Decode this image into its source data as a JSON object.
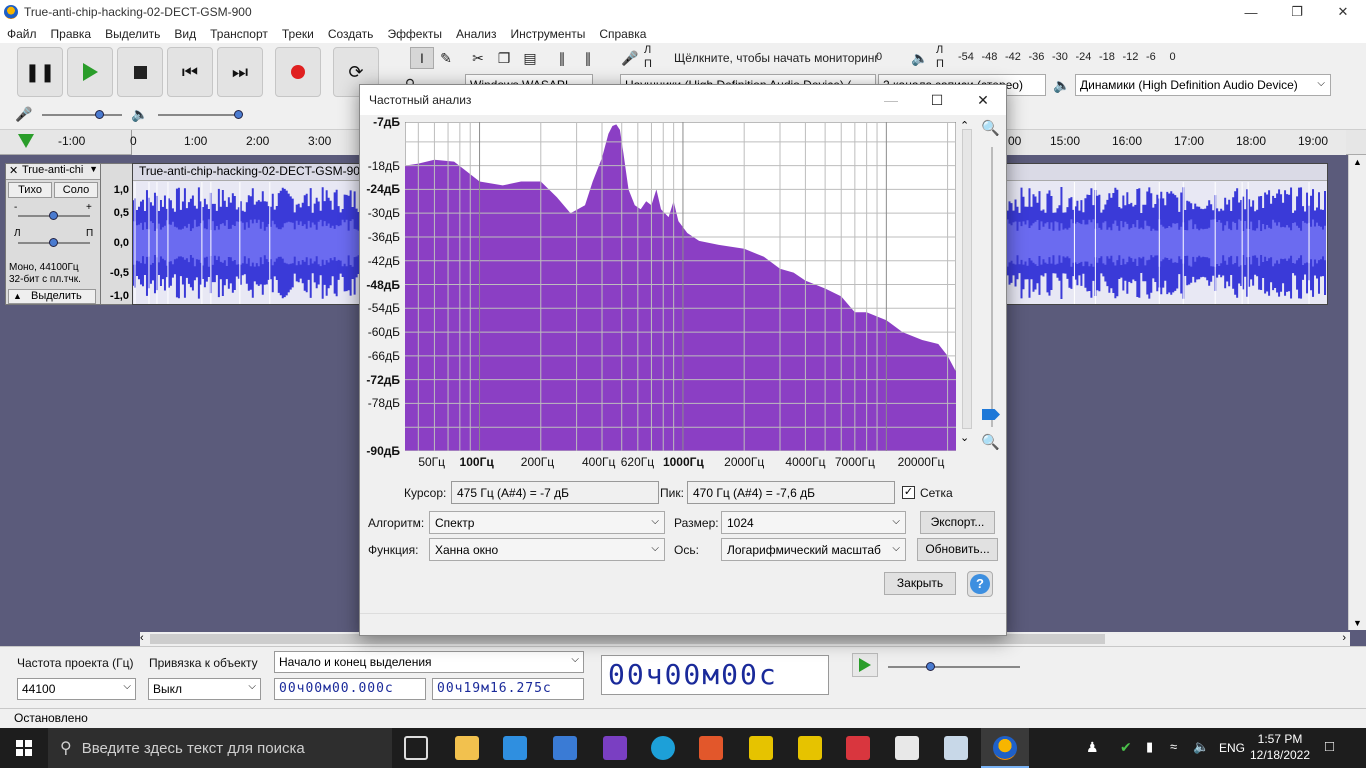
{
  "window": {
    "title": "True-anti-chip-hacking-02-DECT-GSM-900"
  },
  "menu": [
    "Файл",
    "Правка",
    "Выделить",
    "Вид",
    "Транспорт",
    "Треки",
    "Создать",
    "Эффекты",
    "Анализ",
    "Инструменты",
    "Справка"
  ],
  "toolbar": {
    "monitor_text": "Щёлкните, чтобы начать мониторинг",
    "monitor_zero": "0",
    "meter_ticks": [
      "-54",
      "-48",
      "-42",
      "-36",
      "-30",
      "-24",
      "-18",
      "-12",
      "-6",
      "0"
    ],
    "host": "Windows WASAPI",
    "mic_device": "Наушники (High Definition Audio Device) (",
    "channels": "2 канала записи (стерео)",
    "speaker_device": "Динамики (High Definition Audio Device)",
    "lp_l": "Л",
    "lp_r": "П"
  },
  "timeline": {
    "left_ticks": [
      "-1:00",
      "0",
      "1:00",
      "2:00",
      "3:00"
    ],
    "right_ticks": [
      "00",
      "15:00",
      "16:00",
      "17:00",
      "18:00",
      "19:00"
    ]
  },
  "track": {
    "name": "True-anti-chi",
    "clip_name": "True-anti-chip-hacking-02-DECT-GSM-900",
    "mute": "Тихо",
    "solo": "Соло",
    "pan_l": "Л",
    "pan_r": "П",
    "info_line1": "Моно, 44100Гц",
    "info_line2": "32-бит с пл.тчк.",
    "select": "Выделить",
    "scale": [
      "1,0",
      "0,5",
      "0,0",
      "-0,5",
      "-1,0"
    ]
  },
  "bottom": {
    "rate_label": "Частота проекта (Гц)",
    "snap_label": "Привязка к объекту",
    "rate_value": "44100",
    "snap_value": "Выкл",
    "sel_mode": "Начало и конец выделения",
    "sel_start": "00ч00м00.000с",
    "sel_end": "00ч19м16.275с",
    "big_time": "00ч00м00с"
  },
  "status": "Остановлено",
  "taskbar": {
    "search_placeholder": "Введите здесь текст для поиска",
    "lang": "ENG",
    "time": "1:57 PM",
    "date": "12/18/2022"
  },
  "dialog": {
    "title": "Частотный анализ",
    "y_labels": [
      "-7дБ",
      "-18дБ",
      "-24дБ",
      "-30дБ",
      "-36дБ",
      "-42дБ",
      "-48дБ",
      "-54дБ",
      "-60дБ",
      "-66дБ",
      "-72дБ",
      "-78дБ",
      "-90дБ"
    ],
    "x_labels": [
      "50Гц",
      "100Гц",
      "200Гц",
      "400Гц",
      "620Гц",
      "1000Гц",
      "2000Гц",
      "4000Гц",
      "7000Гц",
      "20000Гц"
    ],
    "cursor_label": "Курсор:",
    "cursor_value": "475 Гц (A#4) = -7 дБ",
    "peak_label": "Пик:",
    "peak_value": "470 Гц (A#4) = -7,6 дБ",
    "grid_label": "Сетка",
    "grid_checked": true,
    "algorithm_label": "Алгоритм:",
    "algorithm_value": "Спектр",
    "size_label": "Размер:",
    "size_value": "1024",
    "function_label": "Функция:",
    "function_value": "Ханна  окно",
    "axis_label": "Ось:",
    "axis_value": "Логарифмический масштаб",
    "export_button": "Экспорт...",
    "update_button": "Обновить...",
    "close_button": "Закрыть",
    "help_glyph": "?",
    "fill_color": "#8b3fc4"
  },
  "chart_data": {
    "type": "area",
    "title": "",
    "xlabel": "",
    "ylabel": "",
    "x_scale": "log",
    "xlim": [
      43,
      22000
    ],
    "ylim": [
      -90,
      -7
    ],
    "grid": true,
    "x": [
      43,
      50,
      60,
      75,
      100,
      130,
      160,
      200,
      240,
      280,
      330,
      360,
      400,
      430,
      450,
      470,
      490,
      510,
      540,
      580,
      620,
      660,
      700,
      740,
      780,
      850,
      900,
      950,
      1050,
      1200,
      1500,
      2000,
      2500,
      3000,
      3500,
      4000,
      5000,
      6000,
      7000,
      8000,
      10000,
      12000,
      15000,
      18000,
      20000,
      22000
    ],
    "y": [
      -18,
      -17.5,
      -16.5,
      -17,
      -22,
      -23,
      -22,
      -22,
      -26,
      -30,
      -28,
      -22,
      -16,
      -10,
      -8,
      -7.6,
      -9,
      -15,
      -24,
      -28,
      -29,
      -27,
      -28,
      -24,
      -29,
      -31,
      -27,
      -32,
      -35,
      -37,
      -38,
      -39,
      -41,
      -44,
      -45,
      -47,
      -49,
      -51,
      -55,
      -55,
      -57,
      -60,
      -62,
      -63,
      -66,
      -70
    ]
  }
}
